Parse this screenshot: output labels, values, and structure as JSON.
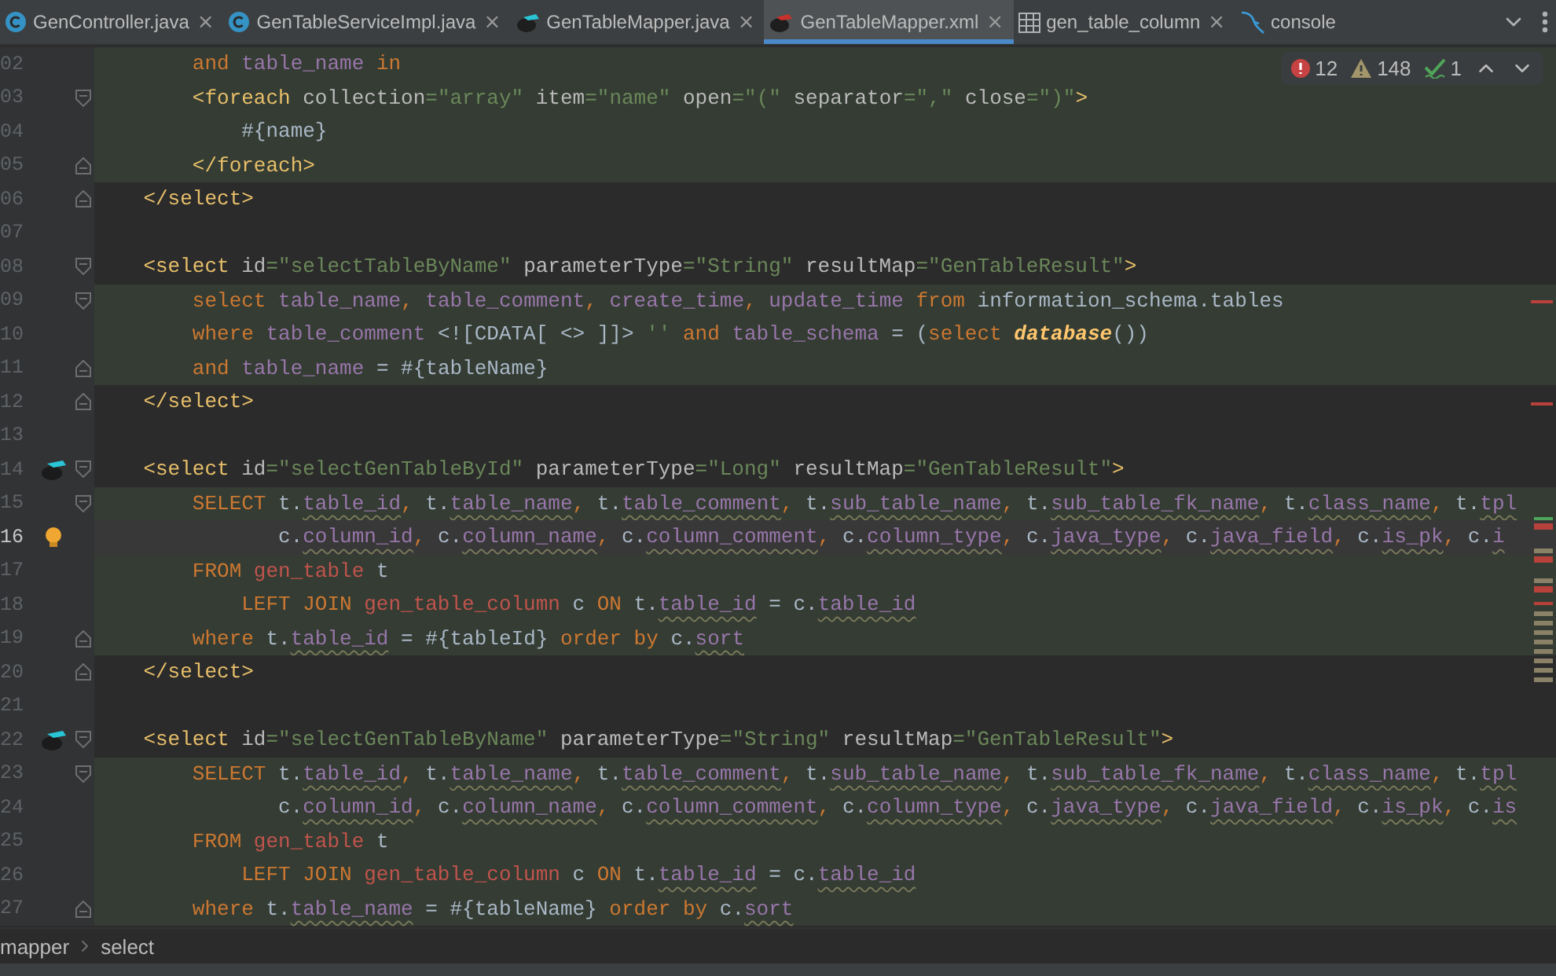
{
  "tabs": [
    {
      "label": "GenController.java",
      "kind": "class",
      "close": "×",
      "selected": false
    },
    {
      "label": "GenTableServiceImpl.java",
      "kind": "class",
      "close": "×",
      "selected": false
    },
    {
      "label": "GenTableMapper.java",
      "kind": "mybatis",
      "close": "×",
      "selected": false
    },
    {
      "label": "GenTableMapper.xml",
      "kind": "mybatis-xml",
      "close": "×",
      "selected": true
    },
    {
      "label": "gen_table_column",
      "kind": "table",
      "close": "×",
      "selected": false
    },
    {
      "label": "console",
      "kind": "console",
      "selected": false
    }
  ],
  "inspections": [
    {
      "kind": "error",
      "count": "12"
    },
    {
      "kind": "warning",
      "count": "148"
    },
    {
      "kind": "typo",
      "count": "1"
    }
  ],
  "lines": [
    {
      "number": "02",
      "injected": true,
      "current": false,
      "tokens": [
        {
          "kind": "kw",
          "text": "        and"
        },
        {
          "kind": "col",
          "text": " table_name"
        },
        {
          "kind": "kw",
          "text": " in"
        }
      ]
    },
    {
      "number": "03",
      "injected": true,
      "current": false,
      "gutter_icons": [
        {
          "kind": "fold-start"
        }
      ],
      "tokens": [
        {
          "kind": "tag",
          "text": "        <foreach"
        },
        {
          "kind": "attr",
          "text": " collection"
        },
        {
          "kind": "str",
          "text": "=\"array\""
        },
        {
          "kind": "attr",
          "text": " item"
        },
        {
          "kind": "str",
          "text": "=\"name\""
        },
        {
          "kind": "attr",
          "text": " open"
        },
        {
          "kind": "str",
          "text": "=\"(\""
        },
        {
          "kind": "attr",
          "text": " separator"
        },
        {
          "kind": "str",
          "text": "=\",\""
        },
        {
          "kind": "attr",
          "text": " close"
        },
        {
          "kind": "str",
          "text": "=\")\""
        },
        {
          "kind": "tag",
          "text": ">"
        }
      ]
    },
    {
      "number": "04",
      "injected": true,
      "current": false,
      "tokens": [
        {
          "kind": "txt",
          "text": "            #{name}"
        }
      ]
    },
    {
      "number": "05",
      "injected": true,
      "current": false,
      "gutter_icons": [
        {
          "kind": "fold-end"
        }
      ],
      "tokens": [
        {
          "kind": "tag",
          "text": "        </foreach>"
        }
      ]
    },
    {
      "number": "06",
      "injected": false,
      "current": false,
      "gutter_icons": [
        {
          "kind": "fold-end"
        }
      ],
      "tokens": [
        {
          "kind": "tag",
          "text": "    </select>"
        }
      ]
    },
    {
      "number": "07",
      "injected": false,
      "current": false
    },
    {
      "number": "08",
      "injected": false,
      "current": false,
      "gutter_icons": [
        {
          "kind": "fold-start"
        }
      ],
      "tokens": [
        {
          "kind": "tag",
          "text": "    <select"
        },
        {
          "kind": "attr",
          "text": " id"
        },
        {
          "kind": "str",
          "text": "=\"selectTableByName\""
        },
        {
          "kind": "attr",
          "text": " parameterType"
        },
        {
          "kind": "str",
          "text": "=\"String\""
        },
        {
          "kind": "attr",
          "text": " resultMap"
        },
        {
          "kind": "str",
          "text": "=\"GenTableResult\""
        },
        {
          "kind": "tag",
          "text": ">"
        }
      ]
    },
    {
      "number": "09",
      "injected": true,
      "current": false,
      "gutter_icons": [
        {
          "kind": "fold-start"
        }
      ],
      "tokens": [
        {
          "kind": "kw",
          "text": "        select"
        },
        {
          "kind": "col",
          "text": " table_name"
        },
        {
          "kind": "punct",
          "text": ","
        },
        {
          "kind": "col",
          "text": " table_comment"
        },
        {
          "kind": "punct",
          "text": ","
        },
        {
          "kind": "col",
          "text": " create_time"
        },
        {
          "kind": "punct",
          "text": ","
        },
        {
          "kind": "col",
          "text": " update_time"
        },
        {
          "kind": "kw",
          "text": " from"
        },
        {
          "kind": "txt",
          "text": " information_schema.tables"
        }
      ]
    },
    {
      "number": "10",
      "injected": true,
      "current": false,
      "tokens": [
        {
          "kind": "kw",
          "text": "        where"
        },
        {
          "kind": "col",
          "text": " table_comment"
        },
        {
          "kind": "txt",
          "text": " <![CDATA[ <> ]]>"
        },
        {
          "kind": "str",
          "text": " ''"
        },
        {
          "kind": "kw",
          "text": " and"
        },
        {
          "kind": "col",
          "text": " table_schema"
        },
        {
          "kind": "txt",
          "text": " = ("
        },
        {
          "kind": "kw",
          "text": "select"
        },
        {
          "kind": "fn",
          "text": " database"
        },
        {
          "kind": "txt",
          "text": "())"
        }
      ]
    },
    {
      "number": "11",
      "injected": true,
      "current": false,
      "gutter_icons": [
        {
          "kind": "fold-end"
        }
      ],
      "tokens": [
        {
          "kind": "kw",
          "text": "        and"
        },
        {
          "kind": "col",
          "text": " table_name"
        },
        {
          "kind": "txt",
          "text": " = #{tableName}"
        }
      ]
    },
    {
      "number": "12",
      "injected": false,
      "current": false,
      "gutter_icons": [
        {
          "kind": "fold-end"
        }
      ],
      "tokens": [
        {
          "kind": "tag",
          "text": "    </select>"
        }
      ]
    },
    {
      "number": "13",
      "injected": false,
      "current": false
    },
    {
      "number": "14",
      "injected": false,
      "current": false,
      "gutter_icons": [
        {
          "kind": "mybatis"
        },
        {
          "kind": "fold-start"
        }
      ],
      "tokens": [
        {
          "kind": "tag",
          "text": "    <select"
        },
        {
          "kind": "attr",
          "text": " id"
        },
        {
          "kind": "str",
          "text": "=\"selectGenTableById\""
        },
        {
          "kind": "attr",
          "text": " parameterType"
        },
        {
          "kind": "str",
          "text": "=\"Long\""
        },
        {
          "kind": "attr",
          "text": " resultMap"
        },
        {
          "kind": "str",
          "text": "=\"GenTableResult\""
        },
        {
          "kind": "tag",
          "text": ">"
        }
      ]
    },
    {
      "number": "15",
      "injected": true,
      "current": false,
      "gutter_icons": [
        {
          "kind": "fold-start"
        }
      ],
      "tokens": [
        {
          "kind": "kw",
          "text": "        SELECT"
        },
        {
          "kind": "txt",
          "text": " t."
        },
        {
          "kind": "colw",
          "text": "table_id"
        },
        {
          "kind": "punct",
          "text": ","
        },
        {
          "kind": "txt",
          "text": " t."
        },
        {
          "kind": "colw",
          "text": "table_name"
        },
        {
          "kind": "punct",
          "text": ","
        },
        {
          "kind": "txt",
          "text": " t."
        },
        {
          "kind": "colw",
          "text": "table_comment"
        },
        {
          "kind": "punct",
          "text": ","
        },
        {
          "kind": "txt",
          "text": " t."
        },
        {
          "kind": "colw",
          "text": "sub_table_name"
        },
        {
          "kind": "punct",
          "text": ","
        },
        {
          "kind": "txt",
          "text": " t."
        },
        {
          "kind": "colw",
          "text": "sub_table_fk_name"
        },
        {
          "kind": "punct",
          "text": ","
        },
        {
          "kind": "txt",
          "text": " t."
        },
        {
          "kind": "colw",
          "text": "class_name"
        },
        {
          "kind": "punct",
          "text": ","
        },
        {
          "kind": "txt",
          "text": " t."
        },
        {
          "kind": "colw",
          "text": "tpl"
        }
      ]
    },
    {
      "number": "16",
      "injected": true,
      "current": true,
      "gutter_icons": [
        {
          "kind": "bulb"
        }
      ],
      "tokens": [
        {
          "kind": "txt",
          "text": "               c."
        },
        {
          "kind": "colw",
          "text": "column_id"
        },
        {
          "kind": "punct",
          "text": ","
        },
        {
          "kind": "txt",
          "text": " c."
        },
        {
          "kind": "colw",
          "text": "column_name"
        },
        {
          "kind": "punct",
          "text": ","
        },
        {
          "kind": "txt",
          "text": " c."
        },
        {
          "kind": "colw",
          "text": "column_comment"
        },
        {
          "kind": "punct",
          "text": ","
        },
        {
          "kind": "txt",
          "text": " c."
        },
        {
          "kind": "colw",
          "text": "column_type"
        },
        {
          "kind": "punct",
          "text": ","
        },
        {
          "kind": "txt",
          "text": " c."
        },
        {
          "kind": "colw",
          "text": "java_type"
        },
        {
          "kind": "punct",
          "text": ","
        },
        {
          "kind": "txt",
          "text": " c."
        },
        {
          "kind": "colw",
          "text": "java_field"
        },
        {
          "kind": "punct",
          "text": ","
        },
        {
          "kind": "txt",
          "text": " c."
        },
        {
          "kind": "colw",
          "text": "is_pk"
        },
        {
          "kind": "punct",
          "text": ","
        },
        {
          "kind": "txt",
          "text": " c."
        },
        {
          "kind": "colw",
          "text": "i"
        }
      ]
    },
    {
      "number": "17",
      "injected": true,
      "current": false,
      "tokens": [
        {
          "kind": "kw",
          "text": "        FROM"
        },
        {
          "kind": "tbl",
          "text": " gen_table"
        },
        {
          "kind": "txt",
          "text": " t"
        }
      ]
    },
    {
      "number": "18",
      "injected": true,
      "current": false,
      "tokens": [
        {
          "kind": "kw",
          "text": "            LEFT JOIN"
        },
        {
          "kind": "tbl",
          "text": " gen_table_column"
        },
        {
          "kind": "txt",
          "text": " c"
        },
        {
          "kind": "kw",
          "text": " ON"
        },
        {
          "kind": "txt",
          "text": " t."
        },
        {
          "kind": "colw",
          "text": "table_id"
        },
        {
          "kind": "txt",
          "text": " = c."
        },
        {
          "kind": "colw",
          "text": "table_id"
        }
      ]
    },
    {
      "number": "19",
      "injected": true,
      "current": false,
      "gutter_icons": [
        {
          "kind": "fold-end"
        }
      ],
      "tokens": [
        {
          "kind": "kw",
          "text": "        where"
        },
        {
          "kind": "txt",
          "text": " t."
        },
        {
          "kind": "colw",
          "text": "table_id"
        },
        {
          "kind": "txt",
          "text": " = #{tableId}"
        },
        {
          "kind": "kw",
          "text": " order by"
        },
        {
          "kind": "txt",
          "text": " c."
        },
        {
          "kind": "colw",
          "text": "sort"
        }
      ]
    },
    {
      "number": "20",
      "injected": false,
      "current": false,
      "gutter_icons": [
        {
          "kind": "fold-end"
        }
      ],
      "tokens": [
        {
          "kind": "tag",
          "text": "    </select>"
        }
      ]
    },
    {
      "number": "21",
      "injected": false,
      "current": false
    },
    {
      "number": "22",
      "injected": false,
      "current": false,
      "gutter_icons": [
        {
          "kind": "mybatis"
        },
        {
          "kind": "fold-start"
        }
      ],
      "tokens": [
        {
          "kind": "tag",
          "text": "    <select"
        },
        {
          "kind": "attr",
          "text": " id"
        },
        {
          "kind": "str",
          "text": "=\"selectGenTableByName\""
        },
        {
          "kind": "attr",
          "text": " parameterType"
        },
        {
          "kind": "str",
          "text": "=\"String\""
        },
        {
          "kind": "attr",
          "text": " resultMap"
        },
        {
          "kind": "str",
          "text": "=\"GenTableResult\""
        },
        {
          "kind": "tag",
          "text": ">"
        }
      ]
    },
    {
      "number": "23",
      "injected": true,
      "current": false,
      "gutter_icons": [
        {
          "kind": "fold-start"
        }
      ],
      "tokens": [
        {
          "kind": "kw",
          "text": "        SELECT"
        },
        {
          "kind": "txt",
          "text": " t."
        },
        {
          "kind": "colw",
          "text": "table_id"
        },
        {
          "kind": "punct",
          "text": ","
        },
        {
          "kind": "txt",
          "text": " t."
        },
        {
          "kind": "colw",
          "text": "table_name"
        },
        {
          "kind": "punct",
          "text": ","
        },
        {
          "kind": "txt",
          "text": " t."
        },
        {
          "kind": "colw",
          "text": "table_comment"
        },
        {
          "kind": "punct",
          "text": ","
        },
        {
          "kind": "txt",
          "text": " t."
        },
        {
          "kind": "colw",
          "text": "sub_table_name"
        },
        {
          "kind": "punct",
          "text": ","
        },
        {
          "kind": "txt",
          "text": " t."
        },
        {
          "kind": "colw",
          "text": "sub_table_fk_name"
        },
        {
          "kind": "punct",
          "text": ","
        },
        {
          "kind": "txt",
          "text": " t."
        },
        {
          "kind": "colw",
          "text": "class_name"
        },
        {
          "kind": "punct",
          "text": ","
        },
        {
          "kind": "txt",
          "text": " t."
        },
        {
          "kind": "colw",
          "text": "tpl"
        }
      ]
    },
    {
      "number": "24",
      "injected": true,
      "current": false,
      "tokens": [
        {
          "kind": "txt",
          "text": "               c."
        },
        {
          "kind": "colw",
          "text": "column_id"
        },
        {
          "kind": "punct",
          "text": ","
        },
        {
          "kind": "txt",
          "text": " c."
        },
        {
          "kind": "colw",
          "text": "column_name"
        },
        {
          "kind": "punct",
          "text": ","
        },
        {
          "kind": "txt",
          "text": " c."
        },
        {
          "kind": "colw",
          "text": "column_comment"
        },
        {
          "kind": "punct",
          "text": ","
        },
        {
          "kind": "txt",
          "text": " c."
        },
        {
          "kind": "colw",
          "text": "column_type"
        },
        {
          "kind": "punct",
          "text": ","
        },
        {
          "kind": "txt",
          "text": " c."
        },
        {
          "kind": "colw",
          "text": "java_type"
        },
        {
          "kind": "punct",
          "text": ","
        },
        {
          "kind": "txt",
          "text": " c."
        },
        {
          "kind": "colw",
          "text": "java_field"
        },
        {
          "kind": "punct",
          "text": ","
        },
        {
          "kind": "txt",
          "text": " c."
        },
        {
          "kind": "colw",
          "text": "is_pk"
        },
        {
          "kind": "punct",
          "text": ","
        },
        {
          "kind": "txt",
          "text": " c."
        },
        {
          "kind": "colw",
          "text": "is"
        }
      ]
    },
    {
      "number": "25",
      "injected": true,
      "current": false,
      "tokens": [
        {
          "kind": "kw",
          "text": "        FROM"
        },
        {
          "kind": "tbl",
          "text": " gen_table"
        },
        {
          "kind": "txt",
          "text": " t"
        }
      ]
    },
    {
      "number": "26",
      "injected": true,
      "current": false,
      "tokens": [
        {
          "kind": "kw",
          "text": "            LEFT JOIN"
        },
        {
          "kind": "tbl",
          "text": " gen_table_column"
        },
        {
          "kind": "txt",
          "text": " c"
        },
        {
          "kind": "kw",
          "text": " ON"
        },
        {
          "kind": "txt",
          "text": " t."
        },
        {
          "kind": "colw",
          "text": "table_id"
        },
        {
          "kind": "txt",
          "text": " = c."
        },
        {
          "kind": "colw",
          "text": "table_id"
        }
      ]
    },
    {
      "number": "27",
      "injected": true,
      "current": false,
      "gutter_icons": [
        {
          "kind": "fold-end"
        }
      ],
      "tokens": [
        {
          "kind": "kw",
          "text": "        where"
        },
        {
          "kind": "txt",
          "text": " t."
        },
        {
          "kind": "colw",
          "text": "table_name"
        },
        {
          "kind": "txt",
          "text": " = #{tableName}"
        },
        {
          "kind": "kw",
          "text": " order by"
        },
        {
          "kind": "txt",
          "text": " c."
        },
        {
          "kind": "colw",
          "text": "sort"
        }
      ]
    }
  ],
  "breadcrumb": [
    "mapper",
    "select"
  ]
}
